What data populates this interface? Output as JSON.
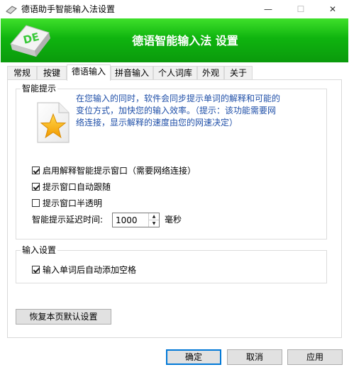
{
  "window": {
    "title": "德语助手智能输入法设置",
    "controls": {
      "minimize": "—",
      "maximize": "☐",
      "close": "✕"
    }
  },
  "banner": {
    "title": "德语智能输入法 设置",
    "logo_text": "DE",
    "colors": {
      "green": "#12b512",
      "logo_text": "#38c838"
    }
  },
  "tabs": [
    {
      "label": "常规",
      "active": false
    },
    {
      "label": "按键",
      "active": false
    },
    {
      "label": "德语输入",
      "active": true
    },
    {
      "label": "拼音输入",
      "active": false
    },
    {
      "label": "个人词库",
      "active": false
    },
    {
      "label": "外观",
      "active": false
    },
    {
      "label": "关于",
      "active": false
    }
  ],
  "smart_hint": {
    "group_title": "智能提示",
    "description": "在您输入的同时，软件会同步提示单词的解释和可能的变位方式，加快您的输入效率。（提示：该功能需要网络连接，显示解释的速度由您的网速决定）",
    "options": [
      {
        "label": "启用解释智能提示窗口（需要网络连接）",
        "checked": true
      },
      {
        "label": "提示窗口自动跟随",
        "checked": true
      },
      {
        "label": "提示窗口半透明",
        "checked": false
      }
    ],
    "delay_label": "智能提示延迟时间:",
    "delay_value": "1000",
    "delay_unit": "毫秒",
    "icon": "star-document-icon"
  },
  "input_settings": {
    "group_title": "输入设置",
    "options": [
      {
        "label": "输入单词后自动添加空格",
        "checked": true
      }
    ]
  },
  "restore_button": "恢复本页默认设置",
  "footer": {
    "ok": "确定",
    "cancel": "取消",
    "apply": "应用"
  }
}
